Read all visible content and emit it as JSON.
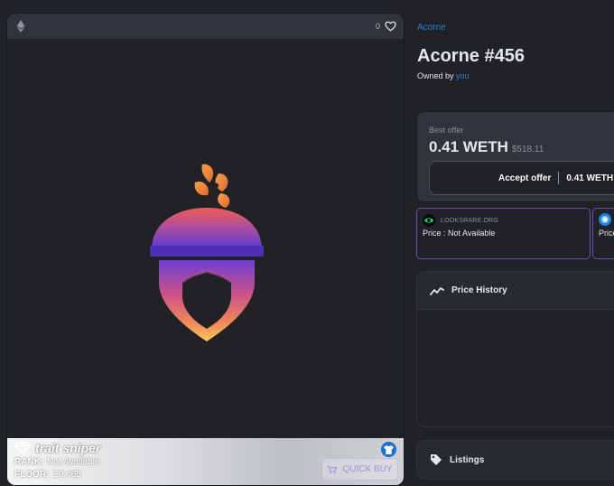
{
  "media": {
    "chain_icon": "ethereum-icon",
    "favorite_count": "0",
    "favorite_icon": "heart-outline-icon",
    "artwork": "acorn-nft-image"
  },
  "trait_sniper": {
    "brand": "trait sniper",
    "brand_icon": "diamond-icon",
    "rank_label": "RANK:",
    "rank_value": "Not Available",
    "floor_label": "FLOOR:",
    "floor_value": "Ξ0.465",
    "quick_buy_label": "QUICK BUY",
    "badge_icon": "shirt-icon"
  },
  "asset": {
    "collection": "Acorne",
    "title": "Acorne #456",
    "owned_by_label": "Owned by",
    "owner": "you"
  },
  "offer": {
    "label": "Best offer",
    "amount": "0.41 WETH",
    "usd": "$518.11",
    "accept_label": "Accept offer",
    "accept_amount": "0.41 WETH"
  },
  "markets": [
    {
      "name": "LOOKSRARE.ORG",
      "price": "Price : Not Available",
      "icon": "looksrare-eye-icon"
    },
    {
      "name": "",
      "price": "Price",
      "icon": "marketplace-logo-icon"
    }
  ],
  "price_history": {
    "label": "Price History",
    "icon": "trend-line-icon"
  },
  "listings": {
    "label": "Listings",
    "icon": "tag-icon"
  },
  "colors": {
    "link": "#2081e2",
    "panel": "#303339",
    "background": "#202225",
    "market_border": "#6f4bbf",
    "quick_buy": "#a98be6"
  }
}
